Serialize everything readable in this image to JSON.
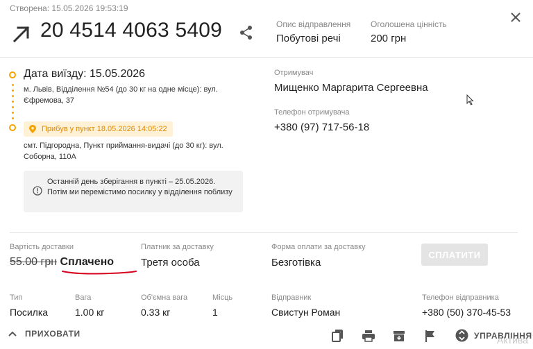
{
  "header": {
    "created": "Створена: 15.05.2026 19:53:19",
    "ttn": "20 4514 4063 5409",
    "description_label": "Опис відправлення",
    "description_value": "Побутові речі",
    "declared_label": "Оголошена цінність",
    "declared_value": "200 грн"
  },
  "route": {
    "departure_title": "Дата виїзду: 15.05.2026",
    "departure_address": "м. Львів, Відділення №54 (до 30 кг на одне місце): вул. Єфремова, 37",
    "arrived_badge": "Прибув у пункт 18.05.2026 14:05:22",
    "arrival_address": "смт. Підгородна, Пункт приймання-видачі (до 30 кг): вул. Соборна, 110А",
    "notice": "Останній день зберігання в пункті – 25.05.2026. Потім ми перемістимо посилку у відділення поблизу"
  },
  "recipient": {
    "name_label": "Отримувач",
    "name_value": "Мищенко Маргарита Сергеевна",
    "phone_label": "Телефон отримувача",
    "phone_value": "+380 (97) 717-56-18"
  },
  "payment": {
    "cost_label": "Вартість доставки",
    "cost_old": "55.00 грн",
    "cost_status": "Сплачено",
    "payer_label": "Платник за доставку",
    "payer_value": "Третя особа",
    "form_label": "Форма оплати за доставку",
    "form_value": "Безготівка",
    "pay_button": "СПЛАТИТИ"
  },
  "details": {
    "type_label": "Тип",
    "type_value": "Посилка",
    "weight_label": "Вага",
    "weight_value": "1.00 кг",
    "volume_label": "Об'ємна вага",
    "volume_value": "0.33 кг",
    "places_label": "Місць",
    "places_value": "1",
    "sender_label": "Відправник",
    "sender_value": "Свистун Роман",
    "sender_phone_label": "Телефон відправника",
    "sender_phone_value": "+380 (50) 370-45-53"
  },
  "footer": {
    "hide_label": "ПРИХОВАТИ",
    "manage_label": "УПРАВЛІННЯ",
    "watermark": "Актива"
  },
  "colors": {
    "accent_orange": "#f5a300",
    "badge_bg": "#fff1d6",
    "annotation_red": "#d8001c",
    "button_disabled": "#e4e4e4"
  },
  "icons": [
    "arrow-up-right-icon",
    "share-icon",
    "close-icon",
    "pin-icon",
    "info-icon",
    "chevron-up-icon",
    "copy-icon",
    "print-icon",
    "archive-icon",
    "flag-icon",
    "manage-icon",
    "cursor-icon"
  ]
}
